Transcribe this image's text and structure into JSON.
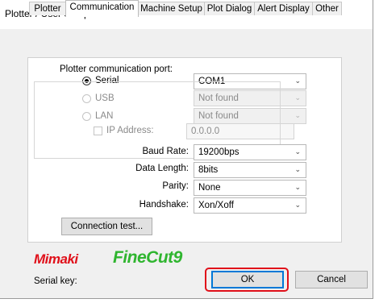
{
  "window": {
    "title": "Plotter / User Setup"
  },
  "tabs": [
    {
      "label": "Plotter"
    },
    {
      "label": "Communication"
    },
    {
      "label": "Machine Setup"
    },
    {
      "label": "Plot Dialog"
    },
    {
      "label": "Alert Display"
    },
    {
      "label": "Other"
    }
  ],
  "communication": {
    "port_heading": "Plotter communication port:",
    "serial": {
      "label": "Serial",
      "selected": true,
      "value": "COM1"
    },
    "usb": {
      "label": "USB",
      "selected": false,
      "value": "Not found"
    },
    "lan": {
      "label": "LAN",
      "selected": false,
      "value": "Not found"
    },
    "ip": {
      "label": "IP Address:",
      "checked": false,
      "value": "0.0.0.0"
    },
    "baud_rate": {
      "label": "Baud Rate:",
      "value": "19200bps"
    },
    "data_length": {
      "label": "Data Length:",
      "value": "8bits"
    },
    "parity": {
      "label": "Parity:",
      "value": "None"
    },
    "handshake": {
      "label": "Handshake:",
      "value": "Xon/Xoff"
    },
    "connection_test_label": "Connection test..."
  },
  "logo": {
    "brand": "Mimaki",
    "product": "FineCut9"
  },
  "footer": {
    "serial_key_label": "Serial key:",
    "ok_label": "OK",
    "cancel_label": "Cancel"
  },
  "colors": {
    "brand_red": "#e0101a",
    "product_green": "#2fb52f",
    "focus_blue": "#0078d7"
  }
}
